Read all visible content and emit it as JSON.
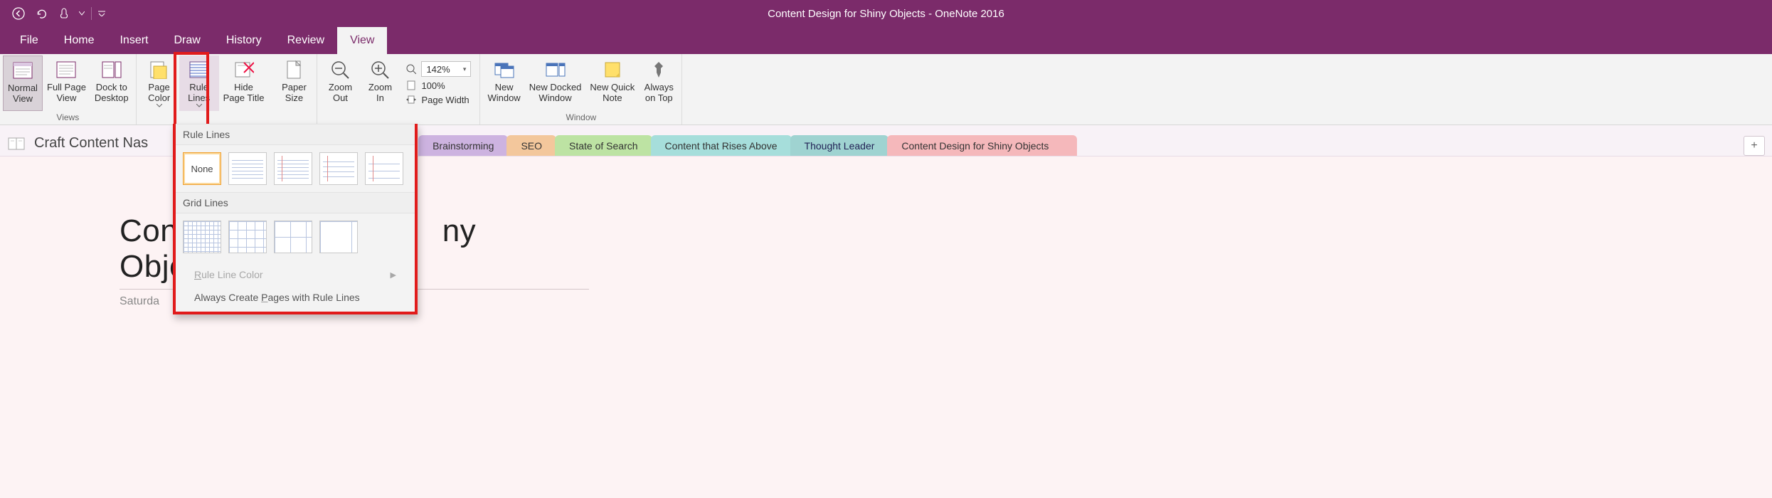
{
  "title": "Content Design for Shiny Objects  -  OneNote 2016",
  "qat": {
    "back": "←",
    "undo": "↶"
  },
  "tabs": {
    "file": "File",
    "home": "Home",
    "insert": "Insert",
    "draw": "Draw",
    "history": "History",
    "review": "Review",
    "view": "View"
  },
  "ribbon": {
    "views": {
      "label": "Views",
      "normal": "Normal\nView",
      "fullpage": "Full Page\nView",
      "dock": "Dock to\nDesktop"
    },
    "pagesetup": {
      "pagecolor": "Page\nColor",
      "rulelines": "Rule\nLines",
      "hidetitle": "Hide\nPage Title",
      "papersize": "Paper\nSize"
    },
    "zoom": {
      "out": "Zoom\nOut",
      "in": "Zoom\nIn",
      "value": "142%",
      "hundred": "100%",
      "pagewidth": "Page Width"
    },
    "window": {
      "label": "Window",
      "new": "New\nWindow",
      "docked": "New Docked\nWindow",
      "quicknote": "New Quick\nNote",
      "ontop": "Always\non Top"
    }
  },
  "dropdown": {
    "rule_header": "Rule Lines",
    "none": "None",
    "grid_header": "Grid Lines",
    "rule_color": "Rule Line Color",
    "always_create": "Always Create Pages with Rule Lines"
  },
  "notebook": {
    "title": "Craft Content Nas",
    "sections": {
      "brainstorming": "Brainstorming",
      "seo": "SEO",
      "state": "State of Search",
      "rises": "Content that Rises Above",
      "leader": "Thought Leader",
      "shiny": "Content Design for Shiny Objects"
    },
    "add": "+"
  },
  "page": {
    "title_left": "Con",
    "title_right": "ny Objects",
    "date": "Saturda"
  }
}
